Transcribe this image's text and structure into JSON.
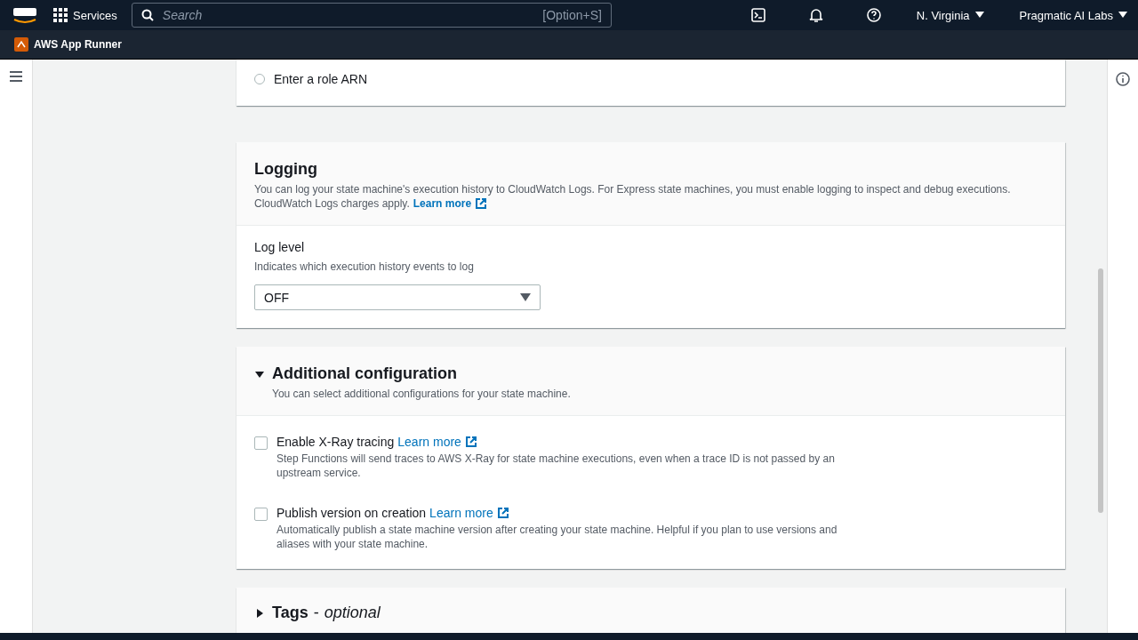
{
  "top_bar": {
    "services": "Services",
    "search": {
      "placeholder": "Search",
      "shortcut": "[Option+S]"
    },
    "region": "N. Virginia",
    "account": "Pragmatic AI Labs"
  },
  "favorites_bar": {
    "service": "AWS App Runner"
  },
  "role_options": [
    {
      "label": "Enter a role ARN",
      "selected": false
    }
  ],
  "logging": {
    "title": "Logging",
    "description": "You can log your state machine's execution history to CloudWatch Logs. For Express state machines, you must enable logging to inspect and debug executions. CloudWatch Logs charges apply.",
    "link": "Learn more",
    "field_label": "Log level",
    "field_hint": "Indicates which execution history events to log",
    "value": "OFF"
  },
  "additional_configuration": {
    "title": "Additional configuration",
    "expanded": true,
    "description": "You can select additional configurations for your state machine.",
    "options": [
      {
        "label": "Enable X-Ray tracing",
        "link": "Learn more",
        "description": "Step Functions will send traces to AWS X-Ray for state machine executions, even when a trace ID is not passed by an upstream service.",
        "checked": false
      },
      {
        "label": "Publish version on creation",
        "link": "Learn more",
        "description": "Automatically publish a state machine version after creating your state machine. Helpful if you plan to use versions and aliases with your state machine.",
        "checked": false
      }
    ]
  },
  "tags": {
    "title": "Tags",
    "separator": "-",
    "suffix": "optional",
    "expanded": false
  }
}
